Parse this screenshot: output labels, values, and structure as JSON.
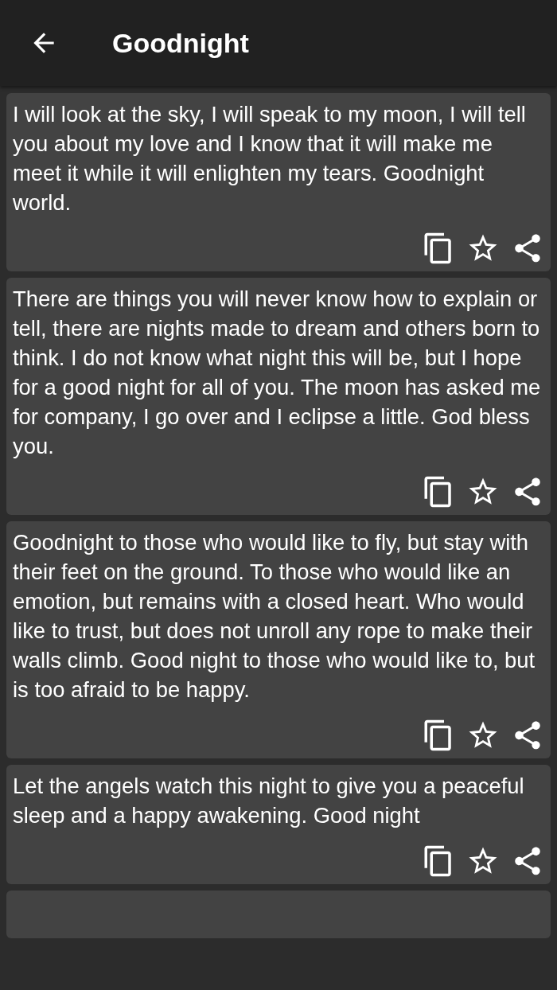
{
  "app_bar": {
    "title": "Goodnight"
  },
  "quotes": [
    {
      "text": "I will look at the sky, I will speak to my moon, I will tell you about my love and I know that it will make me meet it while it will enlighten my tears. Goodnight world."
    },
    {
      "text": "There are things you will never know how to explain or tell, there are nights made to dream and others born to think. I do not know what night this will be, but I hope for a good night for all of you. The moon has asked me for company, I go over and I eclipse a little. God bless you."
    },
    {
      "text": "Goodnight to those who would like to fly, but stay with their feet on the ground. To those who would like an emotion, but remains with a closed heart. Who would like to trust, but does not unroll any rope to make their walls climb. Good night to those who would like to, but is too afraid to be happy."
    },
    {
      "text": "Let the angels watch this night to give you a peaceful sleep and a happy awakening. Good night"
    }
  ]
}
